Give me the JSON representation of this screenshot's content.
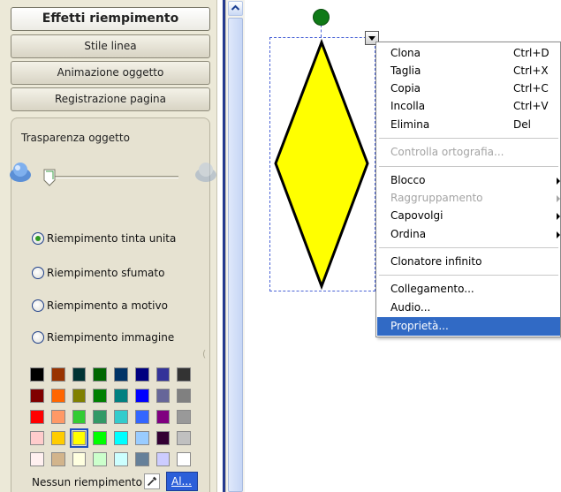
{
  "panel": {
    "tabs": [
      "Effetti riempimento",
      "Stile linea",
      "Animazione oggetto",
      "Registrazione pagina"
    ],
    "transparency_label": "Trasparenza oggetto",
    "transparency_value": 0,
    "fill_options": [
      {
        "label": "Riempimento tinta unita",
        "checked": true
      },
      {
        "label": "Riempimento sfumato",
        "checked": false
      },
      {
        "label": "Riempimento a motivo",
        "checked": false
      },
      {
        "label": "Riempimento immagine",
        "checked": false
      }
    ],
    "palette": [
      [
        "#000000",
        "#993300",
        "#003333",
        "#006600",
        "#003366",
        "#000080",
        "#333399",
        "#333333"
      ],
      [
        "#800000",
        "#ff6600",
        "#808000",
        "#008000",
        "#008080",
        "#0000ff",
        "#666699",
        "#808080"
      ],
      [
        "#ff0000",
        "#ff9966",
        "#33cc33",
        "#339966",
        "#33cccc",
        "#3366ff",
        "#800080",
        "#999999"
      ],
      [
        "#ffcccc",
        "#ffcc00",
        "#ffff00",
        "#00ff00",
        "#00ffff",
        "#99ccff",
        "#330033",
        "#c0c0c0"
      ],
      [
        "#fff0f0",
        "#d2b48c",
        "#ffffe0",
        "#ccffcc",
        "#ccffff",
        "#668099",
        "#ccccff",
        "#ffffff"
      ]
    ],
    "selected_color": "#ffff00",
    "no_fill_label": "Nessun riempimento",
    "more_colors_label": "Al..."
  },
  "canvas": {
    "shape_fill": "#ffff00",
    "shape_stroke": "#000000",
    "rotate_handle_color": "#0f7a17",
    "icons": [
      "rotate-handle-icon",
      "menu-dropdown-icon",
      "eyedropper-icon",
      "transparency-blob-icon"
    ]
  },
  "context_menu": {
    "items": [
      {
        "label": "Clona",
        "shortcut": "Ctrl+D"
      },
      {
        "label": "Taglia",
        "shortcut": "Ctrl+X"
      },
      {
        "label": "Copia",
        "shortcut": "Ctrl+C"
      },
      {
        "label": "Incolla",
        "shortcut": "Ctrl+V"
      },
      {
        "label": "Elimina",
        "shortcut": "Del"
      },
      {
        "label": "Controlla ortografia...",
        "disabled": true
      },
      {
        "label": "Blocco",
        "submenu": true
      },
      {
        "label": "Raggruppamento",
        "submenu": true,
        "disabled": true
      },
      {
        "label": "Capovolgi",
        "submenu": true
      },
      {
        "label": "Ordina",
        "submenu": true
      },
      {
        "label": "Clonatore infinito"
      },
      {
        "label": "Collegamento..."
      },
      {
        "label": "Audio..."
      },
      {
        "label": "Proprietà...",
        "highlighted": true
      }
    ],
    "highlight_color": "#316ac5"
  }
}
